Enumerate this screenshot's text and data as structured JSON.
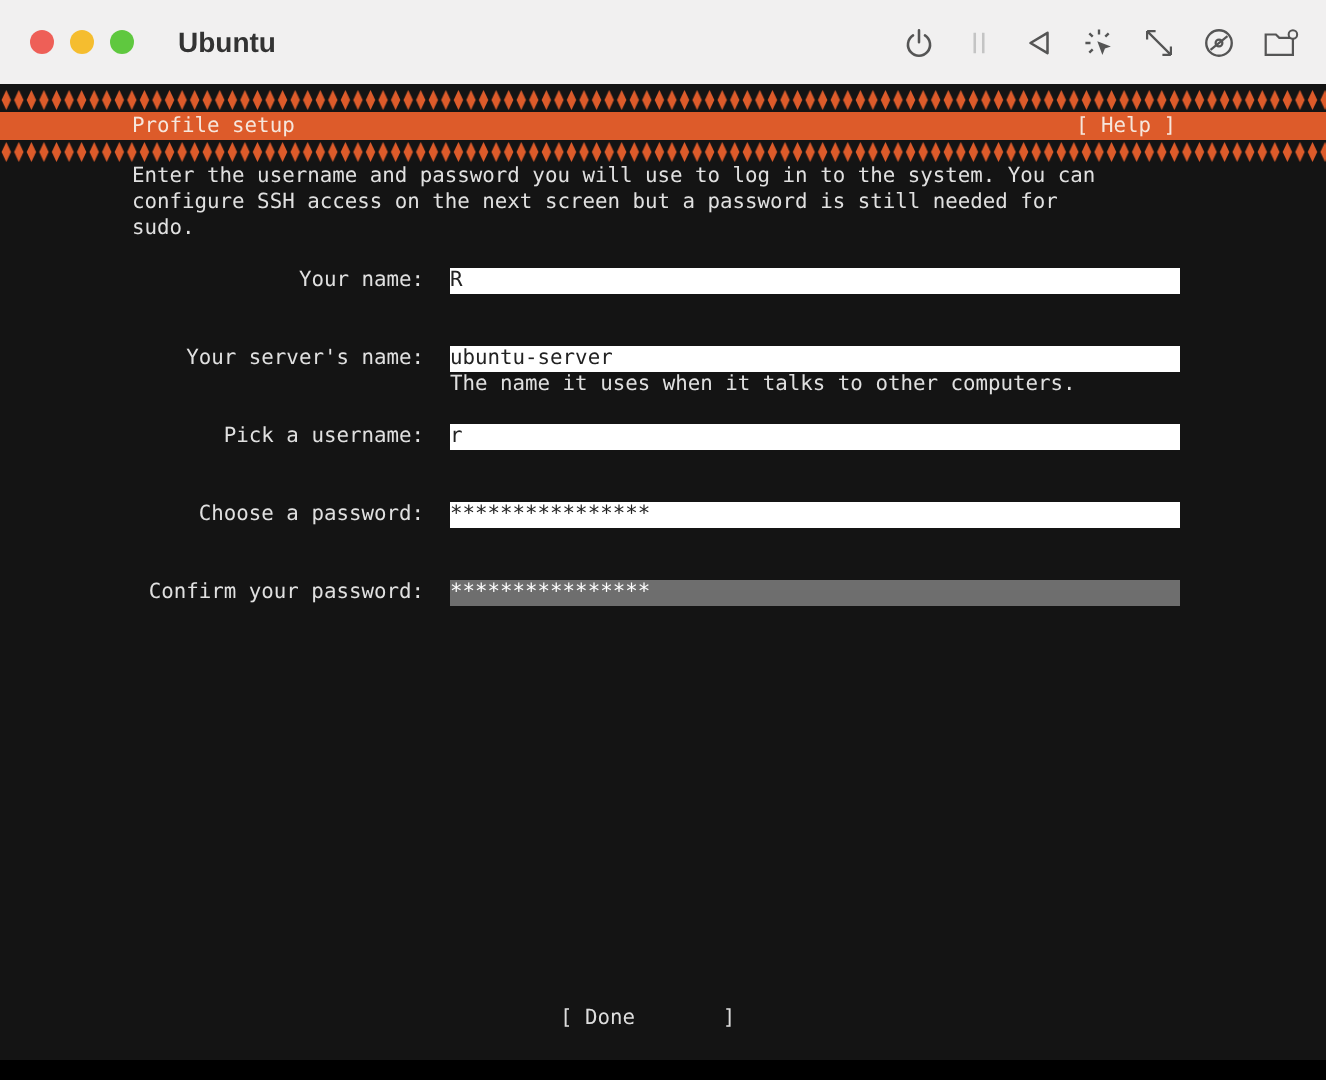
{
  "window": {
    "title": "Ubuntu"
  },
  "toolbar": [
    {
      "kind": "power",
      "disabled": false
    },
    {
      "kind": "pause",
      "disabled": true
    },
    {
      "kind": "back",
      "disabled": false
    },
    {
      "kind": "capture",
      "disabled": false
    },
    {
      "kind": "resize",
      "disabled": false
    },
    {
      "kind": "disc",
      "disabled": false
    },
    {
      "kind": "folder",
      "disabled": false
    }
  ],
  "header": {
    "title": "Profile setup",
    "help": "[ Help ]"
  },
  "intro": "Enter the username and password you will use to log in to the system. You can configure SSH access on the next screen but a password is still needed for sudo.",
  "fields": [
    {
      "label": "Your name:",
      "value": "R",
      "focused": false
    },
    {
      "label": "Your server's name:",
      "value": "ubuntu-server",
      "hint": "The name it uses when it talks to other computers.",
      "focused": false
    },
    {
      "label": "Pick a username:",
      "value": "r",
      "focused": false
    },
    {
      "label": "Choose a password:",
      "value": "****************",
      "focused": false
    },
    {
      "label": "Confirm your password:",
      "value": "****************",
      "focused": true
    }
  ],
  "done_button": "[ Done       ]"
}
